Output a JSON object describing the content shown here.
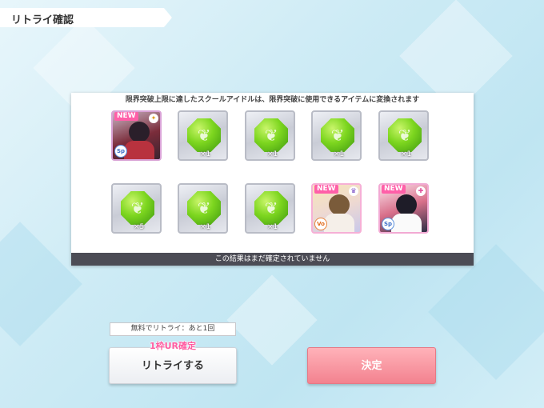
{
  "header": {
    "title": "リトライ確認"
  },
  "panel": {
    "message": "限界突破上限に達したスクールアイドルは、限界突破に使用できるアイテムに変換されます",
    "footer": "この結果はまだ確定されていません"
  },
  "results": {
    "card_1": {
      "badge": "NEW",
      "type": "Sp"
    },
    "item_quantities": [
      "×1",
      "×1",
      "×1",
      "×1",
      "×5",
      "×1",
      "×1"
    ],
    "card_2": {
      "badge": "NEW",
      "type": "Vo"
    },
    "card_3": {
      "badge": "NEW",
      "type": "Sp"
    }
  },
  "retry": {
    "free_label": "無料でリトライ：あと1回",
    "guarantee_label": "1枠UR確定",
    "button_label": "リトライする"
  },
  "confirm": {
    "button_label": "決定"
  },
  "colors": {
    "confirm": "#f3828f",
    "new_badge": "#ff5fa8",
    "footer": "#4c4c55"
  },
  "icons": [
    "gem-icon",
    "attribute-icon",
    "type-icon"
  ]
}
